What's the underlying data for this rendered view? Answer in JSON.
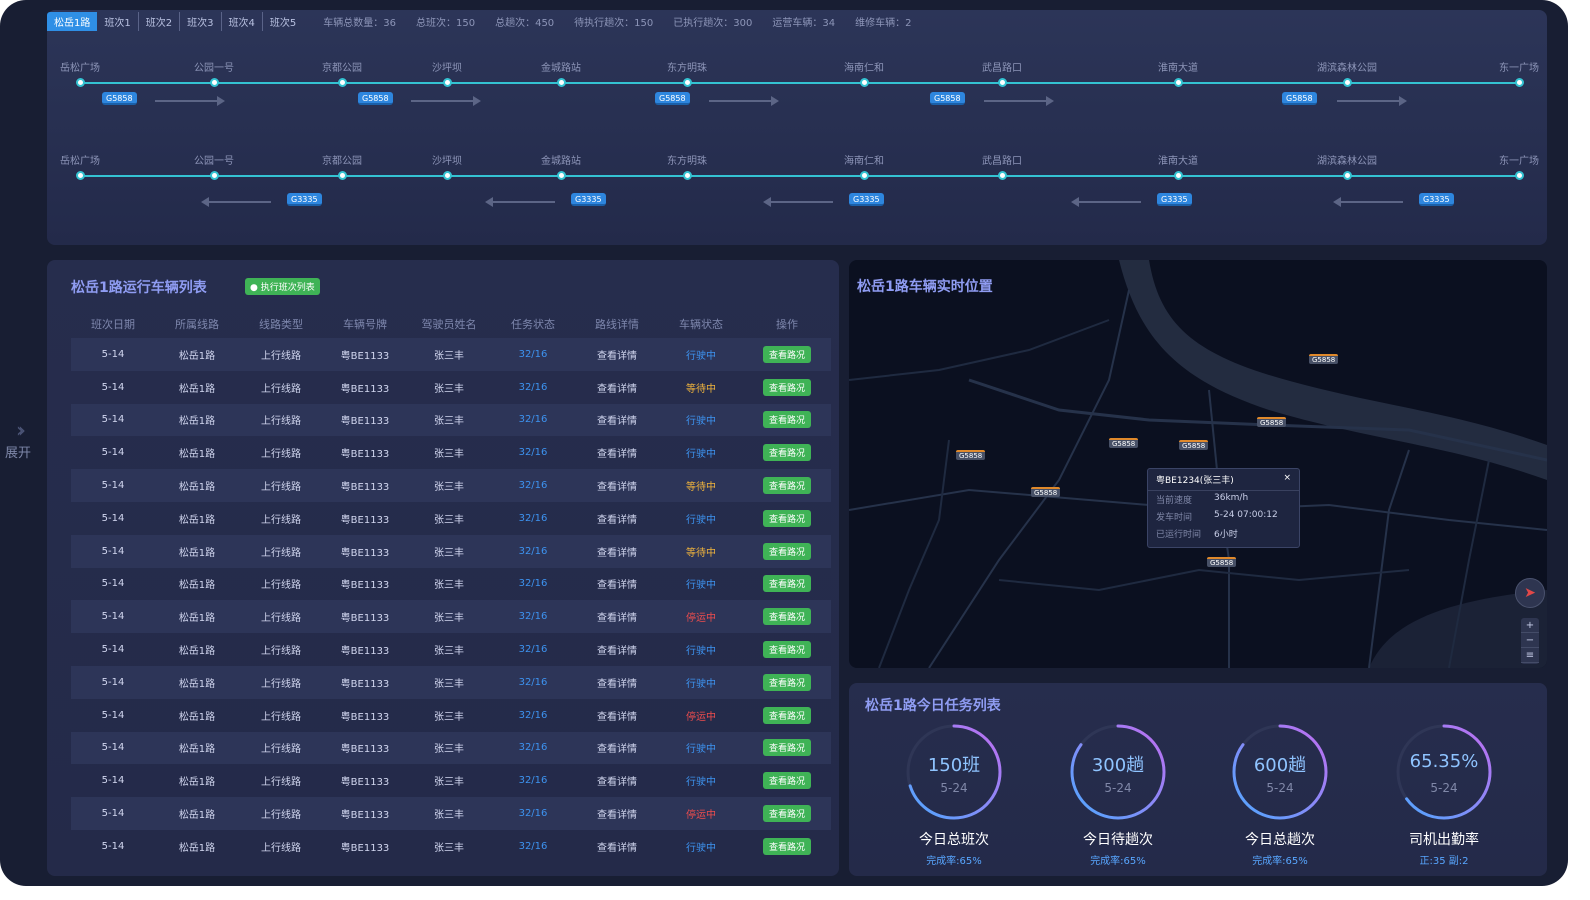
{
  "sidebar": {
    "expand_label": "展开"
  },
  "top": {
    "tabs": [
      "松岳1路",
      "班次1",
      "班次2",
      "班次3",
      "班次4",
      "班次5"
    ],
    "stats": [
      "车辆总数量：36",
      "总班次：150",
      "总趟次：450",
      "待执行趟次：150",
      "已执行趟次：300",
      "运营车辆：34",
      "维修车辆：2"
    ],
    "stops": [
      "岳松广场",
      "公园一号",
      "京都公园",
      "沙坪坝",
      "金城路站",
      "东方明珠",
      "海南仁和",
      "武昌路口",
      "淮南大道",
      "湖滨森林公园",
      "东一广场"
    ],
    "up_bus_label": "G5858",
    "down_bus_label": "G3335"
  },
  "vehicle_list": {
    "title": "松岳1路运行车辆列表",
    "badge": "执行班次列表",
    "columns": [
      "班次日期",
      "所属线路",
      "线路类型",
      "车辆号牌",
      "驾驶员姓名",
      "任务状态",
      "路线详情",
      "车辆状态",
      "操作"
    ],
    "rows": [
      {
        "date": "5-14",
        "line": "松岳1路",
        "type": "上行线路",
        "plate": "粤BE1133",
        "driver": "张三丰",
        "task": "32/16",
        "detail": "查看详情",
        "status": "行驶中",
        "status_class": "running",
        "action": "查看路况"
      },
      {
        "date": "5-14",
        "line": "松岳1路",
        "type": "上行线路",
        "plate": "粤BE1133",
        "driver": "张三丰",
        "task": "32/16",
        "detail": "查看详情",
        "status": "等待中",
        "status_class": "waiting",
        "action": "查看路况"
      },
      {
        "date": "5-14",
        "line": "松岳1路",
        "type": "上行线路",
        "plate": "粤BE1133",
        "driver": "张三丰",
        "task": "32/16",
        "detail": "查看详情",
        "status": "行驶中",
        "status_class": "running",
        "action": "查看路况"
      },
      {
        "date": "5-14",
        "line": "松岳1路",
        "type": "上行线路",
        "plate": "粤BE1133",
        "driver": "张三丰",
        "task": "32/16",
        "detail": "查看详情",
        "status": "行驶中",
        "status_class": "running",
        "action": "查看路况"
      },
      {
        "date": "5-14",
        "line": "松岳1路",
        "type": "上行线路",
        "plate": "粤BE1133",
        "driver": "张三丰",
        "task": "32/16",
        "detail": "查看详情",
        "status": "等待中",
        "status_class": "waiting",
        "action": "查看路况"
      },
      {
        "date": "5-14",
        "line": "松岳1路",
        "type": "上行线路",
        "plate": "粤BE1133",
        "driver": "张三丰",
        "task": "32/16",
        "detail": "查看详情",
        "status": "行驶中",
        "status_class": "running",
        "action": "查看路况"
      },
      {
        "date": "5-14",
        "line": "松岳1路",
        "type": "上行线路",
        "plate": "粤BE1133",
        "driver": "张三丰",
        "task": "32/16",
        "detail": "查看详情",
        "status": "等待中",
        "status_class": "waiting",
        "action": "查看路况"
      },
      {
        "date": "5-14",
        "line": "松岳1路",
        "type": "上行线路",
        "plate": "粤BE1133",
        "driver": "张三丰",
        "task": "32/16",
        "detail": "查看详情",
        "status": "行驶中",
        "status_class": "running",
        "action": "查看路况"
      },
      {
        "date": "5-14",
        "line": "松岳1路",
        "type": "上行线路",
        "plate": "粤BE1133",
        "driver": "张三丰",
        "task": "32/16",
        "detail": "查看详情",
        "status": "停运中",
        "status_class": "stopped",
        "action": "查看路况"
      },
      {
        "date": "5-14",
        "line": "松岳1路",
        "type": "上行线路",
        "plate": "粤BE1133",
        "driver": "张三丰",
        "task": "32/16",
        "detail": "查看详情",
        "status": "行驶中",
        "status_class": "running",
        "action": "查看路况"
      },
      {
        "date": "5-14",
        "line": "松岳1路",
        "type": "上行线路",
        "plate": "粤BE1133",
        "driver": "张三丰",
        "task": "32/16",
        "detail": "查看详情",
        "status": "行驶中",
        "status_class": "running",
        "action": "查看路况"
      },
      {
        "date": "5-14",
        "line": "松岳1路",
        "type": "上行线路",
        "plate": "粤BE1133",
        "driver": "张三丰",
        "task": "32/16",
        "detail": "查看详情",
        "status": "停运中",
        "status_class": "stopped",
        "action": "查看路况"
      },
      {
        "date": "5-14",
        "line": "松岳1路",
        "type": "上行线路",
        "plate": "粤BE1133",
        "driver": "张三丰",
        "task": "32/16",
        "detail": "查看详情",
        "status": "行驶中",
        "status_class": "running",
        "action": "查看路况"
      },
      {
        "date": "5-14",
        "line": "松岳1路",
        "type": "上行线路",
        "plate": "粤BE1133",
        "driver": "张三丰",
        "task": "32/16",
        "detail": "查看详情",
        "status": "行驶中",
        "status_class": "running",
        "action": "查看路况"
      },
      {
        "date": "5-14",
        "line": "松岳1路",
        "type": "上行线路",
        "plate": "粤BE1133",
        "driver": "张三丰",
        "task": "32/16",
        "detail": "查看详情",
        "status": "停运中",
        "status_class": "stopped",
        "action": "查看路况"
      },
      {
        "date": "5-14",
        "line": "松岳1路",
        "type": "上行线路",
        "plate": "粤BE1133",
        "driver": "张三丰",
        "task": "32/16",
        "detail": "查看详情",
        "status": "行驶中",
        "status_class": "running",
        "action": "查看路况"
      }
    ]
  },
  "map": {
    "title": "松岳1路车辆实时位置",
    "popup": {
      "title": "粤BE1234(张三丰)",
      "rows": [
        {
          "k": "当前速度",
          "v": "36km/h"
        },
        {
          "k": "发车时间",
          "v": "5-24 07:00:12"
        },
        {
          "k": "已运行时间",
          "v": "6小时"
        }
      ]
    },
    "bus_label": "G5858"
  },
  "tasks": {
    "title": "松岳1路今日任务列表",
    "cards": [
      {
        "value": "150班",
        "date": "5-24",
        "label": "今日总班次",
        "sub": "完成率:65%",
        "progress": 0.7
      },
      {
        "value": "300趟",
        "date": "5-24",
        "label": "今日待趟次",
        "sub": "完成率:65%",
        "progress": 0.85
      },
      {
        "value": "600趟",
        "date": "5-24",
        "label": "今日总趟次",
        "sub": "完成率:65%",
        "progress": 0.85
      },
      {
        "value": "65.35%",
        "date": "5-24",
        "label": "司机出勤率",
        "sub": "正:35  副:2",
        "progress": 0.65
      }
    ]
  }
}
